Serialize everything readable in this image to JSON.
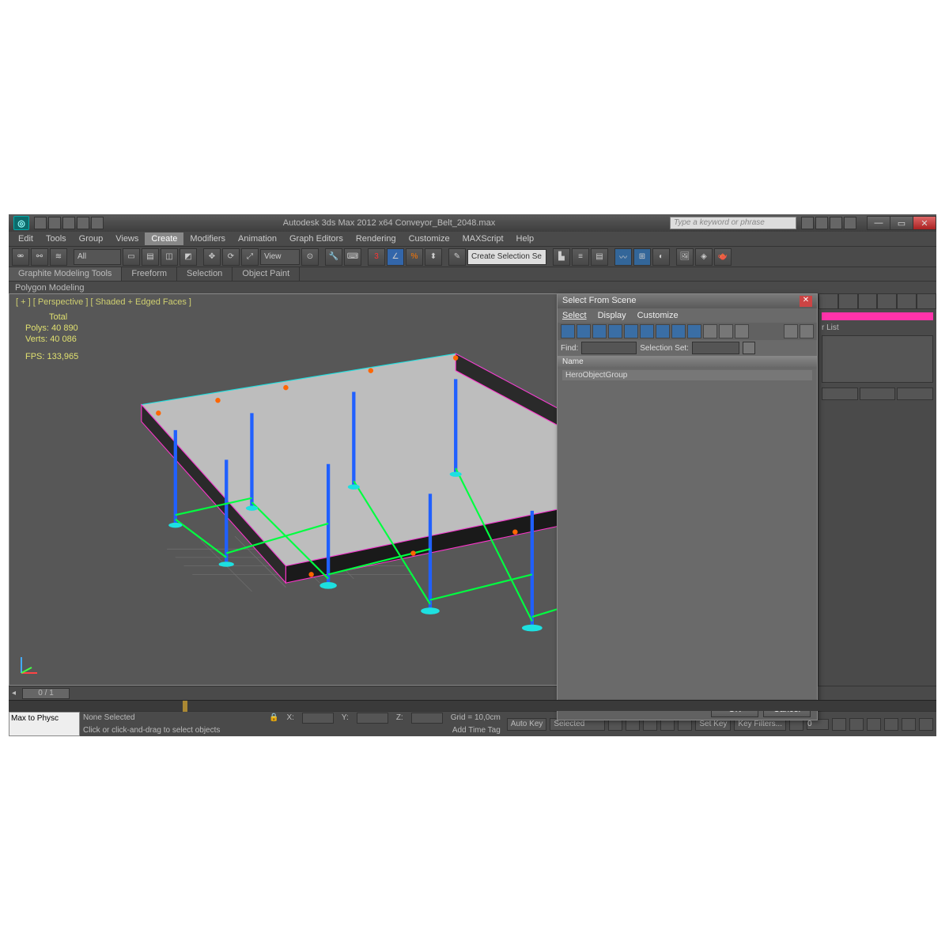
{
  "title": "Autodesk 3ds Max 2012 x64     Conveyor_Belt_2048.max",
  "search_placeholder": "Type a keyword or phrase",
  "menus": [
    "Edit",
    "Tools",
    "Group",
    "Views",
    "Create",
    "Modifiers",
    "Animation",
    "Graph Editors",
    "Rendering",
    "Customize",
    "MAXScript",
    "Help"
  ],
  "active_menu": "Create",
  "ribbon_tabs": [
    "Graphite Modeling Tools",
    "Freeform",
    "Selection",
    "Object Paint"
  ],
  "ribbon_sub": "Polygon Modeling",
  "toolbar_selector": "All",
  "toolbar_view": "View",
  "toolbar_create_sel": "Create Selection Se",
  "viewport": {
    "label": "[ + ] [ Perspective ] [ Shaded + Edged Faces ]",
    "stats_header": "Total",
    "polys_label": "Polys:",
    "polys": "40 890",
    "verts_label": "Verts:",
    "verts": "40 086",
    "fps_label": "FPS:",
    "fps": "133,965"
  },
  "dialog": {
    "title": "Select From Scene",
    "menus": [
      "Select",
      "Display",
      "Customize"
    ],
    "find_label": "Find:",
    "selset_label": "Selection Set:",
    "col_header": "Name",
    "rows": [
      "HeroObjectGroup"
    ],
    "ok": "OK",
    "cancel": "Cancel"
  },
  "rightpanel": {
    "layer_label": "r List"
  },
  "timeslider": {
    "frame": "0 / 1"
  },
  "status": {
    "script": "Max to Physc",
    "selection": "None Selected",
    "prompt": "Click or click-and-drag to select objects",
    "x": "X:",
    "y": "Y:",
    "z": "Z:",
    "grid": "Grid = 10,0cm",
    "addtag": "Add Time Tag",
    "autokey": "Auto Key",
    "setkey": "Set Key",
    "selected": "Selected",
    "keyfilters": "Key Filters...",
    "frame_field": "0"
  }
}
